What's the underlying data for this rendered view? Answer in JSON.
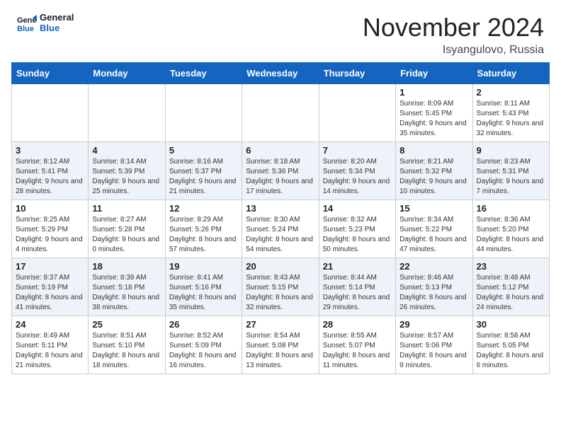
{
  "header": {
    "logo_line1": "General",
    "logo_line2": "Blue",
    "month_title": "November 2024",
    "location": "Isyangulovo, Russia"
  },
  "weekdays": [
    "Sunday",
    "Monday",
    "Tuesday",
    "Wednesday",
    "Thursday",
    "Friday",
    "Saturday"
  ],
  "weeks": [
    [
      {
        "day": "",
        "info": ""
      },
      {
        "day": "",
        "info": ""
      },
      {
        "day": "",
        "info": ""
      },
      {
        "day": "",
        "info": ""
      },
      {
        "day": "",
        "info": ""
      },
      {
        "day": "1",
        "info": "Sunrise: 8:09 AM\nSunset: 5:45 PM\nDaylight: 9 hours and 35 minutes."
      },
      {
        "day": "2",
        "info": "Sunrise: 8:11 AM\nSunset: 5:43 PM\nDaylight: 9 hours and 32 minutes."
      }
    ],
    [
      {
        "day": "3",
        "info": "Sunrise: 8:12 AM\nSunset: 5:41 PM\nDaylight: 9 hours and 28 minutes."
      },
      {
        "day": "4",
        "info": "Sunrise: 8:14 AM\nSunset: 5:39 PM\nDaylight: 9 hours and 25 minutes."
      },
      {
        "day": "5",
        "info": "Sunrise: 8:16 AM\nSunset: 5:37 PM\nDaylight: 9 hours and 21 minutes."
      },
      {
        "day": "6",
        "info": "Sunrise: 8:18 AM\nSunset: 5:36 PM\nDaylight: 9 hours and 17 minutes."
      },
      {
        "day": "7",
        "info": "Sunrise: 8:20 AM\nSunset: 5:34 PM\nDaylight: 9 hours and 14 minutes."
      },
      {
        "day": "8",
        "info": "Sunrise: 8:21 AM\nSunset: 5:32 PM\nDaylight: 9 hours and 10 minutes."
      },
      {
        "day": "9",
        "info": "Sunrise: 8:23 AM\nSunset: 5:31 PM\nDaylight: 9 hours and 7 minutes."
      }
    ],
    [
      {
        "day": "10",
        "info": "Sunrise: 8:25 AM\nSunset: 5:29 PM\nDaylight: 9 hours and 4 minutes."
      },
      {
        "day": "11",
        "info": "Sunrise: 8:27 AM\nSunset: 5:28 PM\nDaylight: 9 hours and 0 minutes."
      },
      {
        "day": "12",
        "info": "Sunrise: 8:29 AM\nSunset: 5:26 PM\nDaylight: 8 hours and 57 minutes."
      },
      {
        "day": "13",
        "info": "Sunrise: 8:30 AM\nSunset: 5:24 PM\nDaylight: 8 hours and 54 minutes."
      },
      {
        "day": "14",
        "info": "Sunrise: 8:32 AM\nSunset: 5:23 PM\nDaylight: 8 hours and 50 minutes."
      },
      {
        "day": "15",
        "info": "Sunrise: 8:34 AM\nSunset: 5:22 PM\nDaylight: 8 hours and 47 minutes."
      },
      {
        "day": "16",
        "info": "Sunrise: 8:36 AM\nSunset: 5:20 PM\nDaylight: 8 hours and 44 minutes."
      }
    ],
    [
      {
        "day": "17",
        "info": "Sunrise: 8:37 AM\nSunset: 5:19 PM\nDaylight: 8 hours and 41 minutes."
      },
      {
        "day": "18",
        "info": "Sunrise: 8:39 AM\nSunset: 5:18 PM\nDaylight: 8 hours and 38 minutes."
      },
      {
        "day": "19",
        "info": "Sunrise: 8:41 AM\nSunset: 5:16 PM\nDaylight: 8 hours and 35 minutes."
      },
      {
        "day": "20",
        "info": "Sunrise: 8:43 AM\nSunset: 5:15 PM\nDaylight: 8 hours and 32 minutes."
      },
      {
        "day": "21",
        "info": "Sunrise: 8:44 AM\nSunset: 5:14 PM\nDaylight: 8 hours and 29 minutes."
      },
      {
        "day": "22",
        "info": "Sunrise: 8:46 AM\nSunset: 5:13 PM\nDaylight: 8 hours and 26 minutes."
      },
      {
        "day": "23",
        "info": "Sunrise: 8:48 AM\nSunset: 5:12 PM\nDaylight: 8 hours and 24 minutes."
      }
    ],
    [
      {
        "day": "24",
        "info": "Sunrise: 8:49 AM\nSunset: 5:11 PM\nDaylight: 8 hours and 21 minutes."
      },
      {
        "day": "25",
        "info": "Sunrise: 8:51 AM\nSunset: 5:10 PM\nDaylight: 8 hours and 18 minutes."
      },
      {
        "day": "26",
        "info": "Sunrise: 8:52 AM\nSunset: 5:09 PM\nDaylight: 8 hours and 16 minutes."
      },
      {
        "day": "27",
        "info": "Sunrise: 8:54 AM\nSunset: 5:08 PM\nDaylight: 8 hours and 13 minutes."
      },
      {
        "day": "28",
        "info": "Sunrise: 8:55 AM\nSunset: 5:07 PM\nDaylight: 8 hours and 11 minutes."
      },
      {
        "day": "29",
        "info": "Sunrise: 8:57 AM\nSunset: 5:06 PM\nDaylight: 8 hours and 9 minutes."
      },
      {
        "day": "30",
        "info": "Sunrise: 8:58 AM\nSunset: 5:05 PM\nDaylight: 8 hours and 6 minutes."
      }
    ]
  ]
}
